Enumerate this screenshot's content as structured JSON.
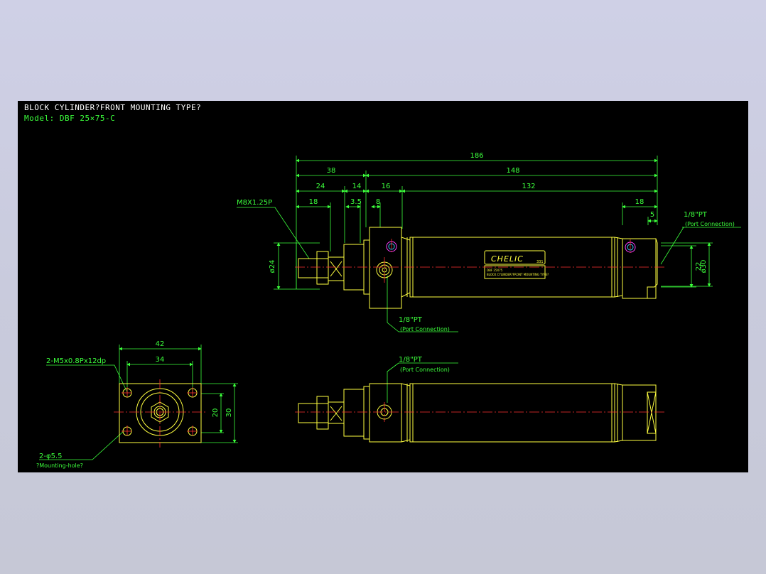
{
  "title": {
    "line1": "BLOCK CYLINDER?FRONT MOUNTING TYPE?",
    "line2": "Model: DBF 25×75-C"
  },
  "side_view": {
    "dims": {
      "overall": "186",
      "rod_side": "38",
      "body": "148",
      "d24": "24",
      "d14": "14",
      "d16": "16",
      "d132": "132",
      "d18_left": "18",
      "d3_5": "3.5",
      "d8": "8",
      "d18_right": "18",
      "d5": "5",
      "d22": "22",
      "d30": "ø30",
      "phi24": "ø24"
    },
    "thread_label": "M8X1.25P",
    "port_front": {
      "size": "1/8\"PT",
      "desc": "(Port Connection)"
    },
    "port_rear": {
      "size": "1/8\"PT",
      "desc": "(Port Connection)"
    },
    "brand": "CHELIC",
    "brand_sub": "331",
    "label_line1": "DBF 25X75",
    "label_line2": "BLOCK CYLINDER?FRONT MOUNTING TYPE?"
  },
  "end_view": {
    "dims": {
      "w42": "42",
      "w34": "34",
      "h20": "20",
      "h30": "30"
    },
    "thread_holes": "2-M5x0.8Px12dp",
    "mount_holes": "2-φ5.5",
    "mount_desc": "?Mounting-hole?"
  },
  "bottom_view": {
    "port": {
      "size": "1/8\"PT",
      "desc": "(Port Connection)"
    }
  },
  "colors": {
    "background": "#000000",
    "dimension": "#3cff3c",
    "outline": "#ffff40",
    "centerline": "#ff3030"
  }
}
